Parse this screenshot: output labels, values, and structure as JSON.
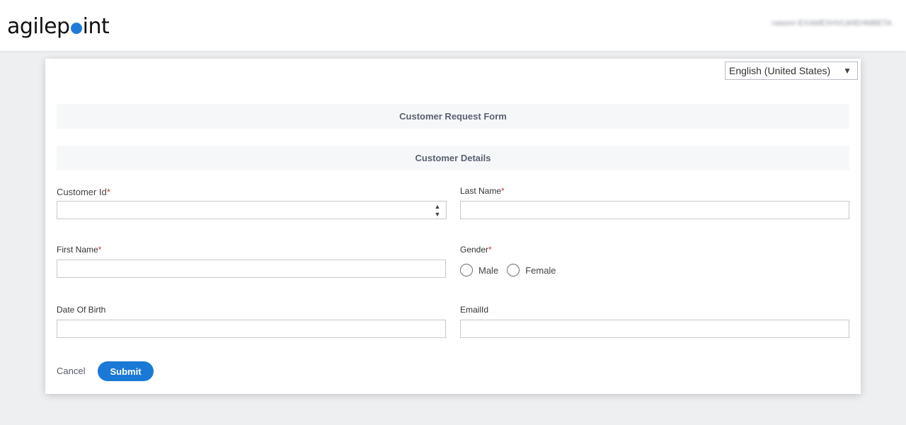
{
  "header": {
    "logo_left": "agilep",
    "logo_right": "int",
    "user_name": "nasonr-EXAMEXHVLWIEHMBETA"
  },
  "form": {
    "language": "English (United States)",
    "title": "Customer Request Form",
    "section_title": "Customer Details",
    "required_marker": "*",
    "fields": {
      "customer_id": {
        "label": "Customer Id",
        "value": ""
      },
      "last_name": {
        "label": "Last Name",
        "value": ""
      },
      "first_name": {
        "label": "First Name",
        "value": ""
      },
      "gender": {
        "label": "Gender",
        "options": [
          "Male",
          "Female"
        ]
      },
      "date_of_birth": {
        "label": "Date Of Birth",
        "value": ""
      },
      "email_id": {
        "label": "EmailId",
        "value": ""
      }
    },
    "actions": {
      "cancel_label": "Cancel",
      "submit_label": "Submit"
    }
  },
  "colors": {
    "accent": "#1a79d6",
    "required": "#d0322d",
    "logo_dot": "#1f7bd8"
  }
}
